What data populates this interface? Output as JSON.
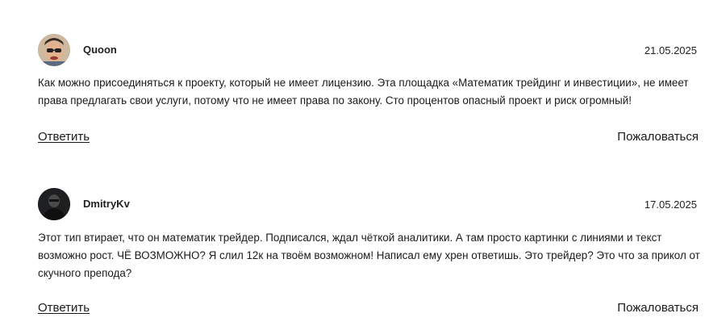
{
  "comments": [
    {
      "author": "Quoon",
      "date": "21.05.2025",
      "text": "Как можно присоединяться к проекту, который не имеет лицензию. Эта площадка «Математик трейдинг и инвестиции», не имеет права предлагать свои услуги, потому что не имеет права по закону. Сто процентов опасный проект и риск огромный!",
      "reply_label": "Ответить",
      "report_label": "Пожаловаться"
    },
    {
      "author": "DmitryKv",
      "date": "17.05.2025",
      "text": "Этот тип втирает, что он математик трейдер. Подписался, ждал чёткой аналитики. А там просто картинки с линиями и текст возможно рост. ЧЁ ВОЗМОЖНО? Я слил 12к на твоём возможном! Написал ему хрен ответишь. Это трейдер? Это что за прикол от скучного препода?",
      "reply_label": "Ответить",
      "report_label": "Пожаловаться"
    }
  ]
}
